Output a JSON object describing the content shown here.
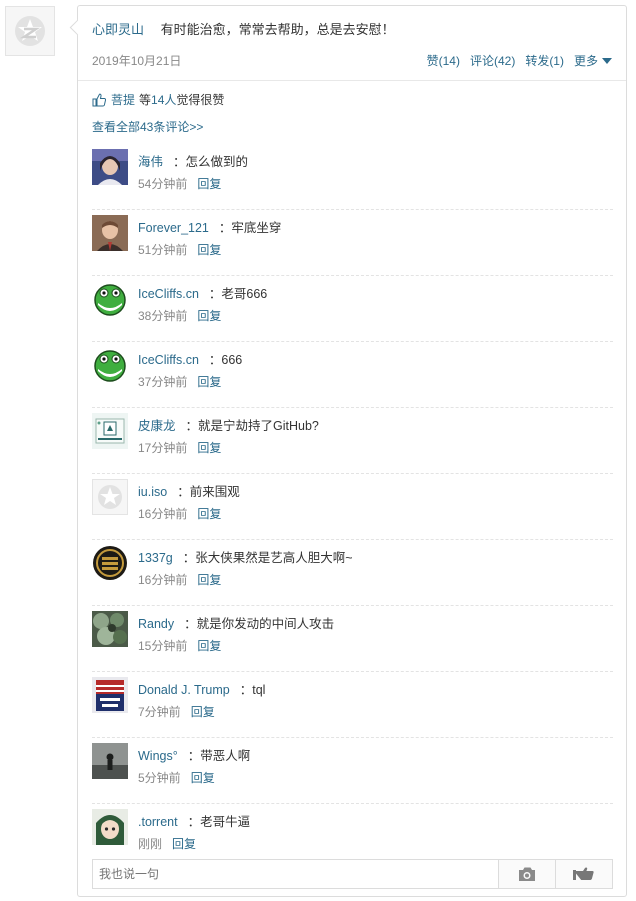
{
  "post": {
    "author": "心即灵山",
    "text": "有时能治愈，常常去帮助，总是去安慰！",
    "date": "2019年10月21日",
    "actions": {
      "like": "赞(14)",
      "comment": "评论(42)",
      "repost": "转发(1)",
      "more": "更多"
    },
    "likes": {
      "user": "菩提",
      "rest_prefix": "等",
      "count": "14人",
      "suffix": "觉得很赞"
    },
    "view_all": "查看全部43条评论>>"
  },
  "comments": [
    {
      "name": "海伟",
      "text": "：怎么做到的",
      "time": "54分钟前",
      "reply": "回复",
      "avatar": "portrait-avatar"
    },
    {
      "name": "Forever_121",
      "text": "：牢底坐穿",
      "time": "51分钟前",
      "reply": "回复",
      "avatar": "portrait-avatar"
    },
    {
      "name": "IceCliffs.cn",
      "text": "：老哥666",
      "time": "38分钟前",
      "reply": "回复",
      "avatar": "green-creature-avatar"
    },
    {
      "name": "IceCliffs.cn",
      "text": "：666",
      "time": "37分钟前",
      "reply": "回复",
      "avatar": "green-creature-avatar"
    },
    {
      "name": "皮康龙",
      "text": "：就是宁劫持了GitHub?",
      "time": "17分钟前",
      "reply": "回复",
      "avatar": "card-avatar"
    },
    {
      "name": "iu.iso",
      "text": "：前来围观",
      "time": "16分钟前",
      "reply": "回复",
      "avatar": "default-avatar"
    },
    {
      "name": "1337g",
      "text": "：张大侠果然是艺高人胆大啊~",
      "time": "16分钟前",
      "reply": "回复",
      "avatar": "coin-avatar"
    },
    {
      "name": "Randy",
      "text": "：就是你发动的中间人攻击",
      "time": "15分钟前",
      "reply": "回复",
      "avatar": "leaves-avatar"
    },
    {
      "name": "Donald J. Trump",
      "text": "：tql",
      "time": "7分钟前",
      "reply": "回复",
      "avatar": "flag-avatar"
    },
    {
      "name": "Wings°",
      "text": "：带恶人啊",
      "time": "5分钟前",
      "reply": "回复",
      "avatar": "silhouette-avatar"
    },
    {
      "name": ".torrent",
      "text": "：老哥牛逼",
      "time": "刚刚",
      "reply": "回复",
      "avatar": "anime-avatar"
    }
  ],
  "composer": {
    "placeholder": "我也说一句"
  },
  "colors": {
    "link": "#2b6a8b",
    "border": "#dcdcdc"
  }
}
